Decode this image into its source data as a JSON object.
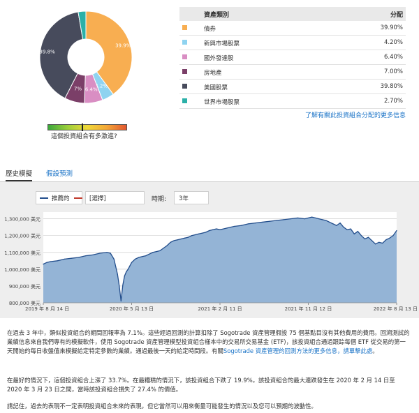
{
  "allocation": {
    "header_name": "資產類別",
    "header_pct": "分配",
    "rows": [
      {
        "name": "債券",
        "pct": "39.90%",
        "value": 39.9,
        "color": "#f8ae51",
        "pie_label": "39.9%"
      },
      {
        "name": "新興市場股票",
        "pct": "4.20%",
        "value": 4.2,
        "color": "#8fd3f0",
        "pie_label": "4.2%"
      },
      {
        "name": "國外發達股",
        "pct": "6.40%",
        "value": 6.4,
        "color": "#d98ec3",
        "pie_label": "6.4%"
      },
      {
        "name": "房地產",
        "pct": "7.00%",
        "value": 7.0,
        "color": "#7b3f68",
        "pie_label": "7%"
      },
      {
        "name": "美國股票",
        "pct": "39.80%",
        "value": 39.8,
        "color": "#474b5c",
        "pie_label": "39.8%"
      },
      {
        "name": "世界市場股票",
        "pct": "2.70%",
        "value": 2.7,
        "color": "#2bb0a8",
        "pie_label": ""
      }
    ],
    "more_link": "了解有關此投資組合分配的更多信息"
  },
  "risk": {
    "label": "這個投資組合有多激進?",
    "gradient": [
      "#3ca83c",
      "#9ccf3a",
      "#f0d838",
      "#f3a637",
      "#e3562f"
    ],
    "level": 0.43
  },
  "tabs": [
    {
      "label": "歷史模擬",
      "active": true
    },
    {
      "label": "假設預測",
      "active": false
    }
  ],
  "chart_controls": {
    "series_label": "推薦的",
    "compare_placeholder": "[選擇]",
    "period_label": "時期:",
    "period_value": "3年"
  },
  "chart_data": {
    "type": "area",
    "series": [
      {
        "name": "推薦的",
        "color": "#234e8c",
        "fill": "#94b4d6"
      }
    ],
    "y_ticks": [
      "1,300,000 美元",
      "1,200,000 美元",
      "1,100,000 美元",
      "1,000,000 美元",
      "900,000 美元",
      "800,000 美元"
    ],
    "y_tick_values": [
      1300000,
      1200000,
      1100000,
      1000000,
      900000,
      800000
    ],
    "ylim": [
      800000,
      1340000
    ],
    "x_ticks": [
      "2019 年 8 月 14 日",
      "2020 年 5 月 13 日",
      "2021 年 2 月 11 日",
      "2021 年 11 月 12 日",
      "2022 年 8 月 13 日"
    ],
    "x_tick_positions": [
      0,
      0.25,
      0.5,
      0.75,
      1.0
    ],
    "x": [
      0,
      0.01,
      0.02,
      0.04,
      0.06,
      0.08,
      0.1,
      0.12,
      0.14,
      0.16,
      0.18,
      0.19,
      0.2,
      0.21,
      0.215,
      0.22,
      0.225,
      0.23,
      0.235,
      0.24,
      0.245,
      0.25,
      0.26,
      0.27,
      0.28,
      0.29,
      0.3,
      0.31,
      0.32,
      0.33,
      0.34,
      0.35,
      0.36,
      0.37,
      0.38,
      0.39,
      0.4,
      0.41,
      0.42,
      0.43,
      0.44,
      0.45,
      0.46,
      0.47,
      0.48,
      0.49,
      0.5,
      0.52,
      0.54,
      0.56,
      0.58,
      0.6,
      0.62,
      0.64,
      0.66,
      0.68,
      0.7,
      0.72,
      0.74,
      0.76,
      0.77,
      0.78,
      0.79,
      0.8,
      0.81,
      0.82,
      0.83,
      0.84,
      0.85,
      0.86,
      0.87,
      0.88,
      0.89,
      0.9,
      0.91,
      0.92,
      0.93,
      0.94,
      0.95,
      0.96,
      0.97,
      0.98,
      0.99,
      1.0
    ],
    "values": [
      1030000,
      1040000,
      1045000,
      1050000,
      1060000,
      1065000,
      1070000,
      1080000,
      1085000,
      1095000,
      1100000,
      1095000,
      1060000,
      970000,
      900000,
      810000,
      905000,
      960000,
      985000,
      1000000,
      1020000,
      1040000,
      1060000,
      1070000,
      1075000,
      1080000,
      1090000,
      1100000,
      1105000,
      1110000,
      1125000,
      1140000,
      1160000,
      1170000,
      1175000,
      1180000,
      1185000,
      1190000,
      1200000,
      1205000,
      1210000,
      1215000,
      1220000,
      1230000,
      1235000,
      1240000,
      1235000,
      1245000,
      1255000,
      1260000,
      1270000,
      1275000,
      1280000,
      1285000,
      1290000,
      1295000,
      1300000,
      1305000,
      1300000,
      1310000,
      1305000,
      1300000,
      1295000,
      1290000,
      1280000,
      1270000,
      1260000,
      1275000,
      1250000,
      1235000,
      1240000,
      1210000,
      1225000,
      1200000,
      1180000,
      1190000,
      1170000,
      1150000,
      1160000,
      1155000,
      1175000,
      1185000,
      1200000,
      1230000
    ],
    "grid": true
  },
  "text": {
    "para1_a": "在過去 3 年中，類似投資組合的期間回報率為 7.1%。這些經過回測的計算扣除了 Sogotrade 資產管理假設 75 個基點目沒有其他費用的費用。回溯測試的業績信息來自我們專有的模擬軟件，使用 Sogotrade 資產管理模型投資組合樣本中的交易所交易基金 (ETF)，該投資組合通過跟踪每個 ETF 從交易的第一天開始的每日收盤值來模擬給定特定參數的業績。通過最後一天的給定時間段。有關",
    "para1_link": "Sogotrade 資產管理的回測方法的更多信息，請單擊此處",
    "para1_b": "。",
    "para2": "在最好的情況下，這個投資組合上漲了 33.7%。在最糟糕的情況下，該投資組合下跌了 19.9%。該投資組合的最大連跌發生在 2020 年 2 月 14 日至 2020 年 3 月 23 日之間，當時該投資組合損失了 27.4% 的價值。",
    "para3": "請記住，過去的表現不一定表明投資組合未來的表現，但它當然可以用來衡量可能發生的情況以及您可以預期的波動性。"
  }
}
